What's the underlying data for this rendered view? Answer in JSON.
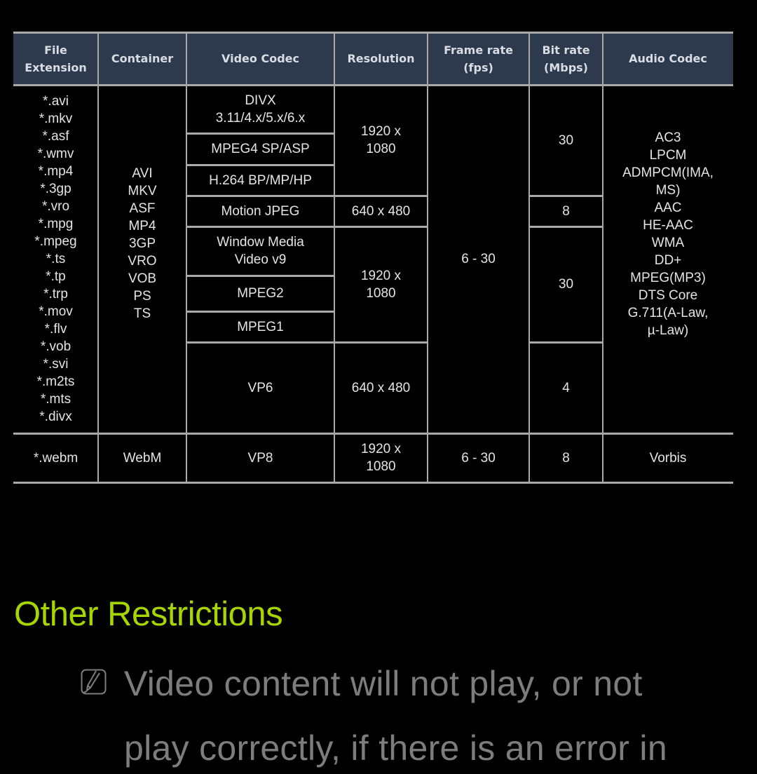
{
  "table": {
    "headers": {
      "file_extension": "File\nExtension",
      "container": "Container",
      "video_codec": "Video Codec",
      "resolution": "Resolution",
      "frame_rate": "Frame rate\n(fps)",
      "bit_rate": "Bit rate\n(Mbps)",
      "audio_codec": "Audio Codec"
    },
    "group1": {
      "file_extensions": [
        "*.avi",
        "*.mkv",
        "*.asf",
        "*.wmv",
        "*.mp4",
        "*.3gp",
        "*.vro",
        "*.mpg",
        "*.mpeg",
        "*.ts",
        "*.tp",
        "*.trp",
        "*.mov",
        "*.flv",
        "*.vob",
        "*.svi",
        "*.m2ts",
        "*.mts",
        "*.divx"
      ],
      "containers": [
        "AVI",
        "MKV",
        "ASF",
        "MP4",
        "3GP",
        "VRO",
        "VOB",
        "PS",
        "TS"
      ],
      "video_codecs": [
        "DIVX\n3.11/4.x/5.x/6.x",
        "MPEG4 SP/ASP",
        "H.264 BP/MP/HP",
        "Motion JPEG",
        "Window Media\nVideo v9",
        "MPEG2",
        "MPEG1",
        "VP6"
      ],
      "resolutions": [
        "1920 x\n1080",
        "640 x 480",
        "1920 x\n1080",
        "640 x 480"
      ],
      "frame_rate": "6 - 30",
      "bit_rates": [
        "30",
        "8",
        "30",
        "4"
      ],
      "audio_codecs": [
        "AC3",
        "LPCM",
        "ADMPCM(IMA,",
        "MS)",
        "AAC",
        "HE-AAC",
        "WMA",
        "DD+",
        "MPEG(MP3)",
        "DTS Core",
        "G.711(A-Law,",
        "µ-Law)"
      ]
    },
    "group2": {
      "file_extension": "*.webm",
      "container": "WebM",
      "video_codec": "VP8",
      "resolution": "1920 x\n1080",
      "frame_rate": "6 - 30",
      "bit_rate": "8",
      "audio_codec": "Vorbis"
    }
  },
  "section": {
    "title": "Other Restrictions",
    "title_color": "#a6d500"
  },
  "note": {
    "icon": "note-pencil-icon",
    "line1": "Video content will not play, or not",
    "line2": "play correctly, if there is an error in"
  }
}
